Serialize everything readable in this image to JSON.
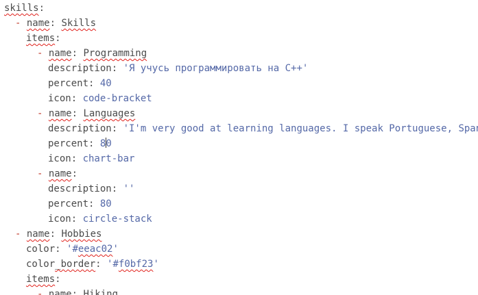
{
  "editor": {
    "lines": [
      {
        "indent": 0,
        "key": "skills",
        "spell": true,
        "tail": ":"
      },
      {
        "indent": 1,
        "dash": true,
        "key": "name",
        "spell": true,
        "sep": ": ",
        "value": "Skills",
        "value_spell": true,
        "value_color": "#4a4a4a"
      },
      {
        "indent": 2,
        "key": "items",
        "spell": true,
        "tail": ":"
      },
      {
        "indent": 3,
        "dash": true,
        "key": "name",
        "spell": true,
        "sep": ": ",
        "value": "Programming",
        "value_spell": true,
        "value_color": "#4a4a4a"
      },
      {
        "indent": 4,
        "key": "description",
        "sep": ": ",
        "value": "'Я учусь программировать на C++'"
      },
      {
        "indent": 4,
        "key": "percent",
        "sep": ": ",
        "value": "40"
      },
      {
        "indent": 4,
        "key": "icon",
        "sep": ": ",
        "value": "code-bracket"
      },
      {
        "indent": 3,
        "dash": true,
        "key": "name",
        "spell": true,
        "sep": ": ",
        "value": "Languages",
        "value_spell": true,
        "value_color": "#4a4a4a"
      },
      {
        "indent": 4,
        "key": "description",
        "sep": ": ",
        "value": "'I'm very good at learning languages. I speak Portuguese, Spanish"
      },
      {
        "indent": 4,
        "key": "percent",
        "sep": ": ",
        "value": "8",
        "caret": true,
        "value_after_caret": "0"
      },
      {
        "indent": 4,
        "key": "icon",
        "sep": ": ",
        "value": "chart-bar"
      },
      {
        "indent": 3,
        "dash": true,
        "key": "name",
        "spell": true,
        "tail": ":"
      },
      {
        "indent": 4,
        "key": "description",
        "sep": ": ",
        "value": "''"
      },
      {
        "indent": 4,
        "key": "percent",
        "sep": ": ",
        "value": "80"
      },
      {
        "indent": 4,
        "key": "icon",
        "sep": ": ",
        "value": "circle-stack"
      },
      {
        "indent": 1,
        "dash": true,
        "key": "name",
        "spell": true,
        "sep": ": ",
        "value": "Hobbies",
        "value_spell": true,
        "value_color": "#4a4a4a"
      },
      {
        "indent": 2,
        "key": "color",
        "sep": ": ",
        "value_prefix": "'#",
        "value": "eeac02",
        "value_spell": true,
        "value_suffix": "'"
      },
      {
        "indent": 2,
        "key": "color",
        "key_tail": "_border",
        "key_tail_spell": true,
        "sep": ": ",
        "value_prefix": "'#",
        "value": "f0bf23",
        "value_spell": true,
        "value_suffix": "'"
      },
      {
        "indent": 2,
        "key": "items",
        "spell": true,
        "tail": ":"
      },
      {
        "indent": 3,
        "dash": true,
        "key": "name",
        "spell": true,
        "sep": ": ",
        "value": "Hiking",
        "value_spell": true,
        "value_color": "#4a4a4a"
      }
    ],
    "colors": {
      "background": "#ffffff",
      "key": "#4a4a4a",
      "dash": "#c0392b",
      "string_value": "#5468a7",
      "spellcheck_squiggle": "#e0201a"
    }
  }
}
